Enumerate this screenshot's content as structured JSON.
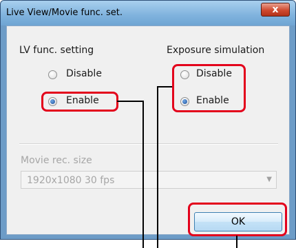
{
  "window": {
    "title": "Live View/Movie func. set.",
    "close_glyph": "x"
  },
  "lv_func": {
    "heading": "LV func. setting",
    "options": [
      {
        "label": "Disable",
        "selected": false
      },
      {
        "label": "Enable",
        "selected": true
      }
    ]
  },
  "exposure_sim": {
    "heading": "Exposure simulation",
    "options": [
      {
        "label": "Disable",
        "selected": false
      },
      {
        "label": "Enable",
        "selected": true
      }
    ]
  },
  "movie": {
    "label": "Movie rec. size",
    "value": "1920x1080  30 fps"
  },
  "buttons": {
    "ok": "OK"
  },
  "colors": {
    "highlight": "#e3001b",
    "title_bar": "#7fb2dd"
  }
}
